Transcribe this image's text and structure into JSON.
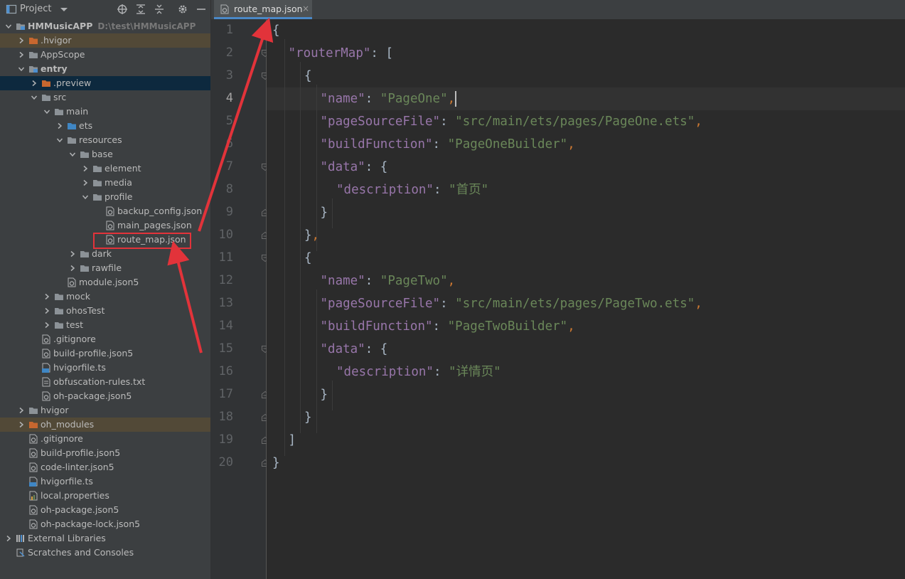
{
  "panel": {
    "title": "Project"
  },
  "tree": [
    {
      "label": "HMMusicAPP",
      "hint": "D:\\test\\HMMusicAPP",
      "depth": 0,
      "arrow": "down",
      "icon": "module-folder",
      "bold": true
    },
    {
      "label": ".hvigor",
      "depth": 1,
      "arrow": "right",
      "icon": "folder-orange",
      "row": "sel-orange"
    },
    {
      "label": "AppScope",
      "depth": 1,
      "arrow": "right",
      "icon": "folder"
    },
    {
      "label": "entry",
      "depth": 1,
      "arrow": "down",
      "icon": "module-folder",
      "bold": true
    },
    {
      "label": ".preview",
      "depth": 2,
      "arrow": "right",
      "icon": "folder-orange",
      "row": "sel-blue"
    },
    {
      "label": "src",
      "depth": 2,
      "arrow": "down",
      "icon": "folder"
    },
    {
      "label": "main",
      "depth": 3,
      "arrow": "down",
      "icon": "folder"
    },
    {
      "label": "ets",
      "depth": 4,
      "arrow": "right",
      "icon": "folder-blue"
    },
    {
      "label": "resources",
      "depth": 4,
      "arrow": "down",
      "icon": "folder"
    },
    {
      "label": "base",
      "depth": 5,
      "arrow": "down",
      "icon": "folder"
    },
    {
      "label": "element",
      "depth": 6,
      "arrow": "right",
      "icon": "folder"
    },
    {
      "label": "media",
      "depth": 6,
      "arrow": "right",
      "icon": "folder"
    },
    {
      "label": "profile",
      "depth": 6,
      "arrow": "down",
      "icon": "folder"
    },
    {
      "label": "backup_config.json",
      "depth": 7,
      "arrow": "none",
      "icon": "json-file"
    },
    {
      "label": "main_pages.json",
      "depth": 7,
      "arrow": "none",
      "icon": "json-file"
    },
    {
      "label": "route_map.json",
      "depth": 7,
      "arrow": "none",
      "icon": "json-file"
    },
    {
      "label": "dark",
      "depth": 5,
      "arrow": "right",
      "icon": "folder"
    },
    {
      "label": "rawfile",
      "depth": 5,
      "arrow": "right",
      "icon": "folder"
    },
    {
      "label": "module.json5",
      "depth": 4,
      "arrow": "none",
      "icon": "json-file"
    },
    {
      "label": "mock",
      "depth": 3,
      "arrow": "right",
      "icon": "folder"
    },
    {
      "label": "ohosTest",
      "depth": 3,
      "arrow": "right",
      "icon": "folder"
    },
    {
      "label": "test",
      "depth": 3,
      "arrow": "right",
      "icon": "folder"
    },
    {
      "label": ".gitignore",
      "depth": 2,
      "arrow": "none",
      "icon": "json-file"
    },
    {
      "label": "build-profile.json5",
      "depth": 2,
      "arrow": "none",
      "icon": "json-file"
    },
    {
      "label": "hvigorfile.ts",
      "depth": 2,
      "arrow": "none",
      "icon": "ts-file"
    },
    {
      "label": "obfuscation-rules.txt",
      "depth": 2,
      "arrow": "none",
      "icon": "text-file"
    },
    {
      "label": "oh-package.json5",
      "depth": 2,
      "arrow": "none",
      "icon": "json-file"
    },
    {
      "label": "hvigor",
      "depth": 1,
      "arrow": "right",
      "icon": "folder"
    },
    {
      "label": "oh_modules",
      "depth": 1,
      "arrow": "right",
      "icon": "folder-orange",
      "row": "sel-orange"
    },
    {
      "label": ".gitignore",
      "depth": 1,
      "arrow": "none",
      "icon": "json-file"
    },
    {
      "label": "build-profile.json5",
      "depth": 1,
      "arrow": "none",
      "icon": "json-file"
    },
    {
      "label": "code-linter.json5",
      "depth": 1,
      "arrow": "none",
      "icon": "json-file"
    },
    {
      "label": "hvigorfile.ts",
      "depth": 1,
      "arrow": "none",
      "icon": "ts-file"
    },
    {
      "label": "local.properties",
      "depth": 1,
      "arrow": "none",
      "icon": "properties-file"
    },
    {
      "label": "oh-package.json5",
      "depth": 1,
      "arrow": "none",
      "icon": "json-file"
    },
    {
      "label": "oh-package-lock.json5",
      "depth": 1,
      "arrow": "none",
      "icon": "json-file"
    },
    {
      "label": "External Libraries",
      "depth": 0,
      "arrow": "right",
      "icon": "libraries"
    },
    {
      "label": "Scratches and Consoles",
      "depth": 0,
      "arrow": "none",
      "icon": "scratches"
    }
  ],
  "editor": {
    "tab_label": "route_map.json",
    "tab_close": "×",
    "current_line": 4,
    "lines": [
      {
        "no": "1",
        "indent": 0,
        "parts": [
          [
            "br",
            "{"
          ]
        ]
      },
      {
        "no": "2",
        "indent": 1,
        "parts": [
          [
            "k",
            "\"routerMap\""
          ],
          [
            "br",
            ": ["
          ]
        ]
      },
      {
        "no": "3",
        "indent": 2,
        "parts": [
          [
            "br",
            "{"
          ]
        ]
      },
      {
        "no": "4",
        "indent": 3,
        "parts": [
          [
            "k",
            "\"name\""
          ],
          [
            "br",
            ": "
          ],
          [
            "s",
            "\"PageOne\""
          ],
          [
            "p",
            ","
          ]
        ]
      },
      {
        "no": "5",
        "indent": 3,
        "parts": [
          [
            "k",
            "\"pageSourceFile\""
          ],
          [
            "br",
            ": "
          ],
          [
            "s",
            "\"src/main/ets/pages/PageOne.ets\""
          ],
          [
            "p",
            ","
          ]
        ]
      },
      {
        "no": "6",
        "indent": 3,
        "parts": [
          [
            "k",
            "\"buildFunction\""
          ],
          [
            "br",
            ": "
          ],
          [
            "s",
            "\"PageOneBuilder\""
          ],
          [
            "p",
            ","
          ]
        ]
      },
      {
        "no": "7",
        "indent": 3,
        "parts": [
          [
            "k",
            "\"data\""
          ],
          [
            "br",
            ": {"
          ]
        ]
      },
      {
        "no": "8",
        "indent": 4,
        "parts": [
          [
            "k",
            "\"description\""
          ],
          [
            "br",
            ": "
          ],
          [
            "s",
            "\"首页\""
          ]
        ]
      },
      {
        "no": "9",
        "indent": 3,
        "parts": [
          [
            "br",
            "}"
          ]
        ]
      },
      {
        "no": "10",
        "indent": 2,
        "parts": [
          [
            "br",
            "}"
          ],
          [
            "p",
            ","
          ]
        ]
      },
      {
        "no": "11",
        "indent": 2,
        "parts": [
          [
            "br",
            "{"
          ]
        ]
      },
      {
        "no": "12",
        "indent": 3,
        "parts": [
          [
            "k",
            "\"name\""
          ],
          [
            "br",
            ": "
          ],
          [
            "s",
            "\"PageTwo\""
          ],
          [
            "p",
            ","
          ]
        ]
      },
      {
        "no": "13",
        "indent": 3,
        "parts": [
          [
            "k",
            "\"pageSourceFile\""
          ],
          [
            "br",
            ": "
          ],
          [
            "s",
            "\"src/main/ets/pages/PageTwo.ets\""
          ],
          [
            "p",
            ","
          ]
        ]
      },
      {
        "no": "14",
        "indent": 3,
        "parts": [
          [
            "k",
            "\"buildFunction\""
          ],
          [
            "br",
            ": "
          ],
          [
            "s",
            "\"PageTwoBuilder\""
          ],
          [
            "p",
            ","
          ]
        ]
      },
      {
        "no": "15",
        "indent": 3,
        "parts": [
          [
            "k",
            "\"data\""
          ],
          [
            "br",
            ": {"
          ]
        ]
      },
      {
        "no": "16",
        "indent": 4,
        "parts": [
          [
            "k",
            "\"description\""
          ],
          [
            "br",
            ": "
          ],
          [
            "s",
            "\"详情页\""
          ]
        ]
      },
      {
        "no": "17",
        "indent": 3,
        "parts": [
          [
            "br",
            "}"
          ]
        ]
      },
      {
        "no": "18",
        "indent": 2,
        "parts": [
          [
            "br",
            "}"
          ]
        ]
      },
      {
        "no": "19",
        "indent": 1,
        "parts": [
          [
            "br",
            "]"
          ]
        ]
      },
      {
        "no": "20",
        "indent": 0,
        "parts": [
          [
            "br",
            "}"
          ]
        ]
      }
    ]
  },
  "colors": {
    "annotation": "#e2333a",
    "json_key": "#9876aa",
    "json_string": "#6a8759",
    "punctuation": "#cc7832"
  }
}
